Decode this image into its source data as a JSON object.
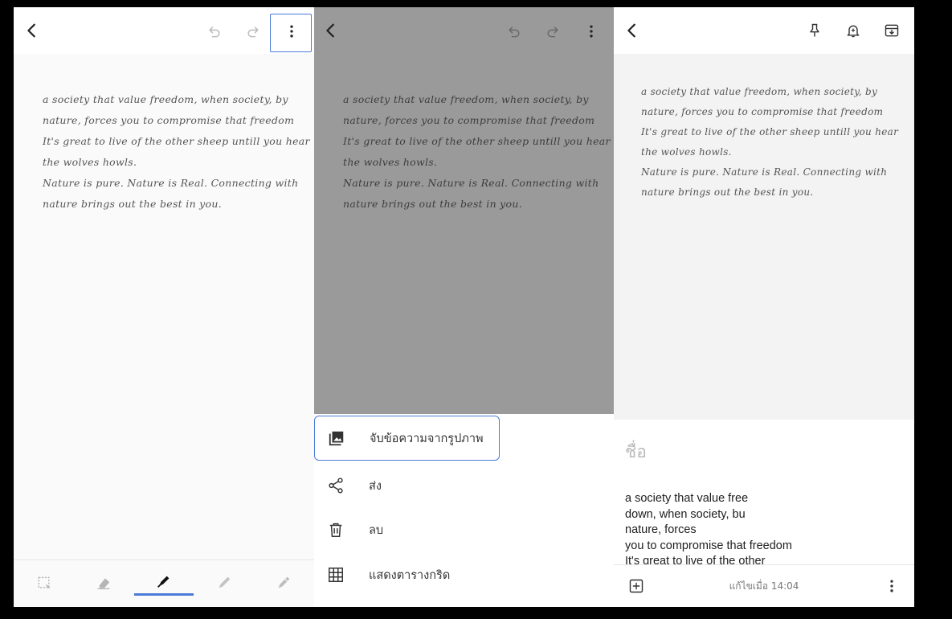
{
  "colors": {
    "accent": "#4a7bd6",
    "scrim": "#9a9a9a",
    "panel_bg": "#fafafa"
  },
  "handwriting": [
    "a society that value freedom, when society, by",
    "nature, forces you to compromise that freedom",
    "It's great to live of the other sheep untill you hear",
    "the wolves howls.",
    "Nature is pure. Nature is Real. Connecting with",
    "nature brings out the best in you."
  ],
  "panel1": {
    "icons": {
      "back": "back-arrow-icon",
      "undo": "undo-icon",
      "redo": "redo-icon",
      "more": "more-vert-icon"
    },
    "tools": [
      "lasso-select-icon",
      "eraser-icon",
      "marker-icon",
      "pencil-icon",
      "pen-icon"
    ]
  },
  "panel2": {
    "menu": [
      {
        "label": "จับข้อความจากรูปภาพ",
        "icon": "image-icon"
      },
      {
        "label": "ส่ง",
        "icon": "share-icon"
      },
      {
        "label": "ลบ",
        "icon": "trash-icon"
      },
      {
        "label": "แสดงตารางกริด",
        "icon": "grid-icon"
      }
    ]
  },
  "panel3": {
    "icons": [
      "pin-icon",
      "reminder-bell-icon",
      "archive-icon"
    ],
    "title_placeholder": "ชื่อ",
    "body_lines": [
      "a society that value free",
      "down, when society, bu",
      "nature, forces",
      "you to compromise that freedom",
      "It's great to live of the other"
    ],
    "edited": "แก้ไขเมื่อ 14:04"
  }
}
